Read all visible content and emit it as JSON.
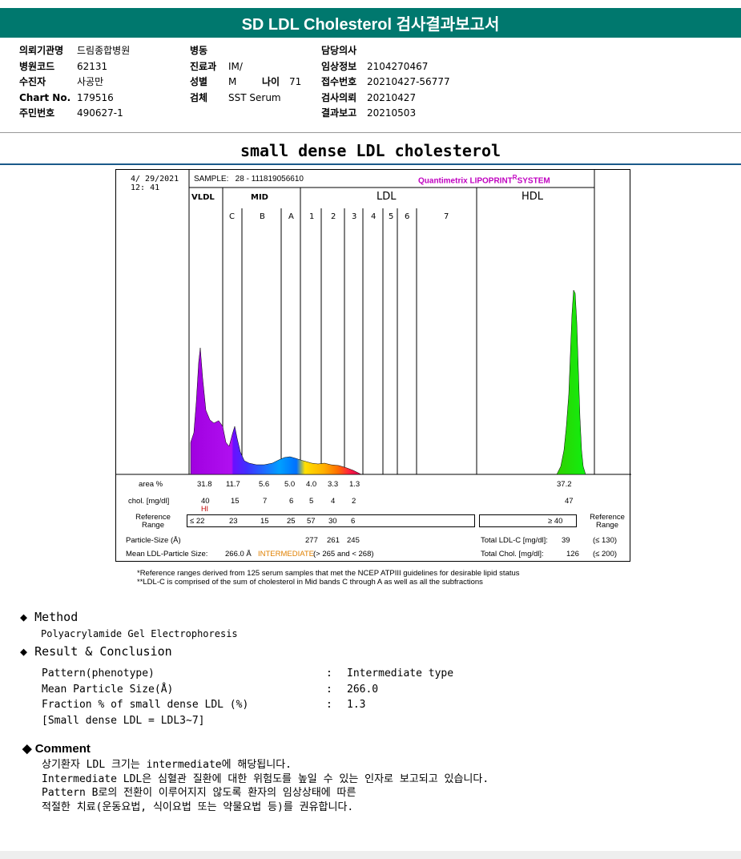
{
  "header": {
    "title": "SD LDL Cholesterol 검사결과보고서"
  },
  "patient": {
    "col1": [
      {
        "label": "의뢰기관명",
        "value": "드림종합병원"
      },
      {
        "label": "병원코드",
        "value": "62131"
      },
      {
        "label": "수진자",
        "value": "사공만"
      },
      {
        "label": "Chart No.",
        "value": "179516"
      },
      {
        "label": "주민번호",
        "value": "490627-1"
      }
    ],
    "col2": [
      {
        "label": "병동",
        "value": ""
      },
      {
        "label": "진료과",
        "value": "IM/"
      },
      {
        "label": "성별",
        "value": "M"
      },
      {
        "label": "검체",
        "value": "SST Serum"
      }
    ],
    "age": {
      "label": "나이",
      "value": "71"
    },
    "col3": [
      {
        "label": "담당의사",
        "value": ""
      },
      {
        "label": "임상정보",
        "value": "2104270467"
      },
      {
        "label": "접수번호",
        "value": "20210427-56777"
      },
      {
        "label": "검사의뢰",
        "value": "20210427"
      },
      {
        "label": "결과보고",
        "value": "20210503"
      }
    ]
  },
  "section_title": "small dense LDL cholesterol",
  "report": {
    "date": "4/ 29/2021",
    "time": "12: 41",
    "sample": "SAMPLE:   28 - 111819056610",
    "brand": "Quantimetrix LIPOPRINT",
    "brand_suffix": "SYSTEM",
    "brand_mark": "R",
    "groups": {
      "vldl": "VLDL",
      "mid": "MID",
      "ldl": "LDL",
      "hdl": "HDL"
    },
    "bands": [
      "C",
      "B",
      "A",
      "1",
      "2",
      "3",
      "4",
      "5",
      "6",
      "7"
    ],
    "row_labels": {
      "area": "area %",
      "chol": "chol. [mg/dl]",
      "ref": "Reference Range",
      "ref_right": "Reference Range"
    },
    "area": [
      "31.8",
      "11.7",
      "5.6",
      "5.0",
      "4.0",
      "3.3",
      "1.3"
    ],
    "area_hdl": "37.2",
    "chol": [
      "40",
      "15",
      "7",
      "6",
      "5",
      "4",
      "2"
    ],
    "chol_hdl": "47",
    "hi_flag": "HI",
    "ref_first": "≤ 22",
    "ref": [
      "23",
      "15",
      "25",
      "57",
      "30",
      "6"
    ],
    "ref_hdl": "≥ 40",
    "particle_label": "Particle-Size (Å)",
    "particle_values": [
      "277",
      "261",
      "245"
    ],
    "mean_label": "Mean LDL-Particle Size:",
    "mean_value": "266.0 Å",
    "mean_class": "INTERMEDIATE",
    "mean_range": "(> 265 and < 268)",
    "total_ldl_label": "Total LDL-C [mg/dl]:",
    "total_ldl_value": "39",
    "total_ldl_ref": "(≤ 130)",
    "total_chol_label": "Total Chol. [mg/dl]:",
    "total_chol_value": "126",
    "total_chol_ref": "(≤ 200)"
  },
  "footnotes": [
    "*Reference ranges derived from 125 serum samples that met the NCEP ATPIII guidelines for desirable lipid status",
    "**LDL-C is comprised of the sum of cholesterol in Mid bands C through A as well as all the subfractions"
  ],
  "method": {
    "title": "Method",
    "text": "Polyacrylamide Gel Electrophoresis"
  },
  "result": {
    "title": "Result & Conclusion",
    "rows": [
      {
        "label": "Pattern(phenotype)",
        "value": "Intermediate type"
      },
      {
        "label": "Mean Particle Size(Å)",
        "value": "266.0"
      },
      {
        "label": "Fraction % of small dense LDL (%)",
        "value": "1.3"
      }
    ],
    "note": "[Small dense LDL = LDL3~7]"
  },
  "comment": {
    "title": "Comment",
    "lines": [
      "상기환자 LDL 크기는 intermediate에 해당됩니다.",
      "Intermediate LDL은 심혈관 질환에 대한 위험도를 높일 수 있는 인자로 보고되고 있습니다.",
      "Pattern B로의 전환이 이루어지지 않도록 환자의 임상상태에 따른",
      "적절한 치료(운동요법, 식이요법 또는 약물요법 등)를 권유합니다."
    ]
  },
  "colors": {
    "header": "#00786e",
    "brand": "#c000c0"
  }
}
